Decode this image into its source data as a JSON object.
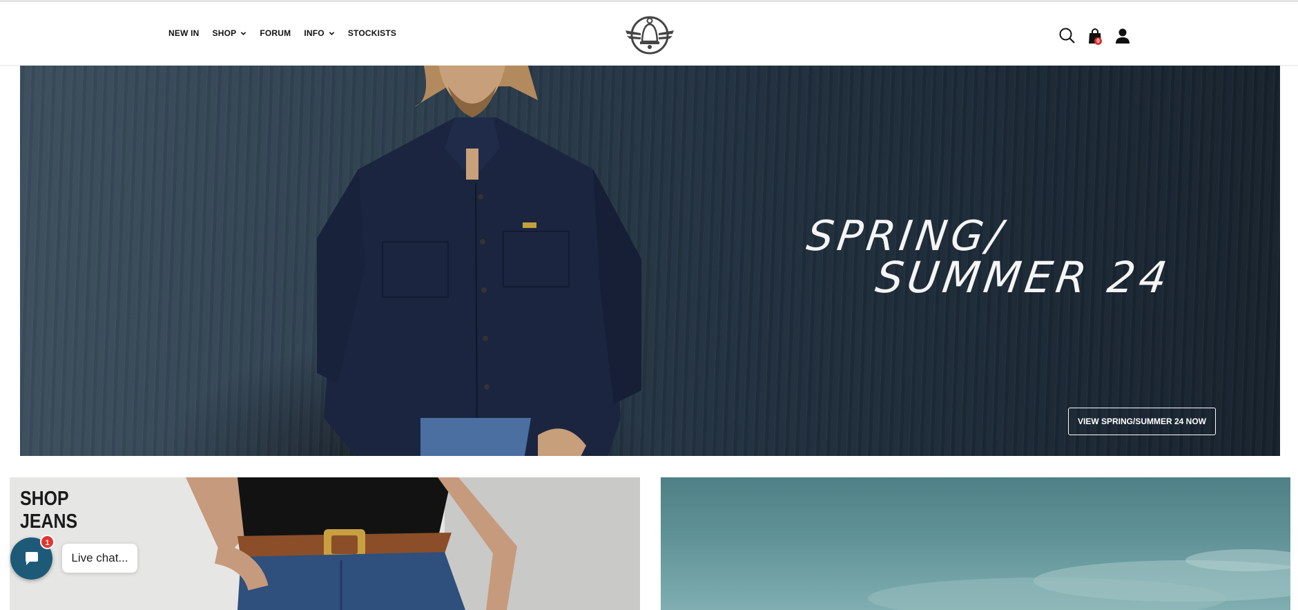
{
  "nav": {
    "items": [
      {
        "label": "NEW IN",
        "dropdown": false
      },
      {
        "label": "SHOP",
        "dropdown": true
      },
      {
        "label": "FORUM",
        "dropdown": false
      },
      {
        "label": "INFO",
        "dropdown": true
      },
      {
        "label": "STOCKISTS",
        "dropdown": false
      }
    ]
  },
  "header": {
    "logo_icon": "bell-with-wings-icon",
    "icons": [
      "search-icon",
      "shopping-bag-icon",
      "user-icon"
    ],
    "cart_count": "0"
  },
  "hero": {
    "title_line1": "SPRING/",
    "title_line2": "SUMMER 24",
    "cta_label": "VIEW SPRING/SUMMER 24 NOW"
  },
  "tiles": {
    "left": {
      "line1": "SHOP",
      "line2": "JEANS"
    }
  },
  "chat": {
    "badge": "1",
    "label": "Live chat..."
  },
  "colors": {
    "chat_bubble": "#1c5a78",
    "badge": "#e3342f",
    "hero_bg": "#1f2e3c"
  }
}
